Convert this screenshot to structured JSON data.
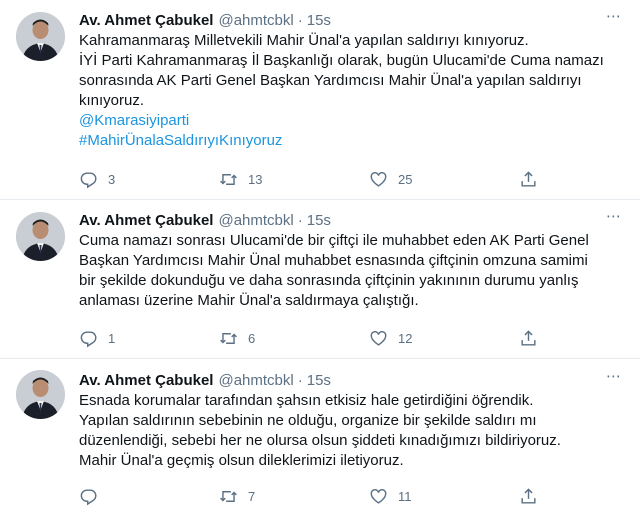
{
  "tweets": [
    {
      "author": {
        "name": "Av. Ahmet Çabukel",
        "handle": "@ahmtcbkl"
      },
      "time": "15s",
      "lines": [
        {
          "text": "Kahramanmaraş Milletvekili Mahir Ünal'a yapılan saldırıyı kınıyoruz."
        },
        {
          "text": "İYİ Parti Kahramanmaraş İl Başkanlığı olarak, bugün Ulucami'de Cuma namazı"
        },
        {
          "text": "sonrasında AK Parti Genel Başkan Yardımcısı Mahir Ünal'a yapılan saldırıyı"
        },
        {
          "text": "kınıyoruz."
        }
      ],
      "links": [
        "@Kmarasiyiparti",
        "#MahirÜnalaSaldırıyıKınıyoruz"
      ],
      "stats": {
        "replies": "3",
        "retweets": "13",
        "likes": "25"
      }
    },
    {
      "author": {
        "name": "Av. Ahmet Çabukel",
        "handle": "@ahmtcbkl"
      },
      "time": "15s",
      "lines": [
        {
          "text": "Cuma namazı sonrası Ulucami'de bir çiftçi ile muhabbet eden AK Parti Genel"
        },
        {
          "text": "Başkan Yardımcısı Mahir Ünal muhabbet esnasında çiftçinin omzuna samimi"
        },
        {
          "text": "bir şekilde dokunduğu ve daha sonrasında çiftçinin yakınının durumu yanlış"
        },
        {
          "text": "anlaması üzerine Mahir Ünal'a saldırmaya çalıştığı."
        }
      ],
      "links": [],
      "stats": {
        "replies": "1",
        "retweets": "6",
        "likes": "12"
      }
    },
    {
      "author": {
        "name": "Av. Ahmet Çabukel",
        "handle": "@ahmtcbkl"
      },
      "time": "15s",
      "lines": [
        {
          "text": "Esnada korumalar tarafından şahsın etkisiz hale getirdiğini öğrendik."
        },
        {
          "text": "Yapılan saldırının sebebinin ne olduğu, organize bir şekilde saldırı mı"
        },
        {
          "text": "düzenlendiği, sebebi her ne olursa olsun şiddeti kınadığımızı bildiriyoruz."
        },
        {
          "text": "Mahir Ünal'a geçmiş olsun dileklerimizi iletiyoruz."
        }
      ],
      "links": [],
      "stats": {
        "replies": "",
        "retweets": "7",
        "likes": "11"
      }
    }
  ],
  "ui": {
    "separator": "·",
    "more_glyph": "⋯"
  },
  "icons": {
    "reply": "reply-icon",
    "retweet": "retweet-icon",
    "like": "heart-icon",
    "share": "share-icon",
    "more": "more-icon"
  },
  "colors": {
    "text": "#0f1419",
    "secondary": "#5b7083",
    "link": "#1b95e0",
    "border": "#e6ecf0"
  }
}
